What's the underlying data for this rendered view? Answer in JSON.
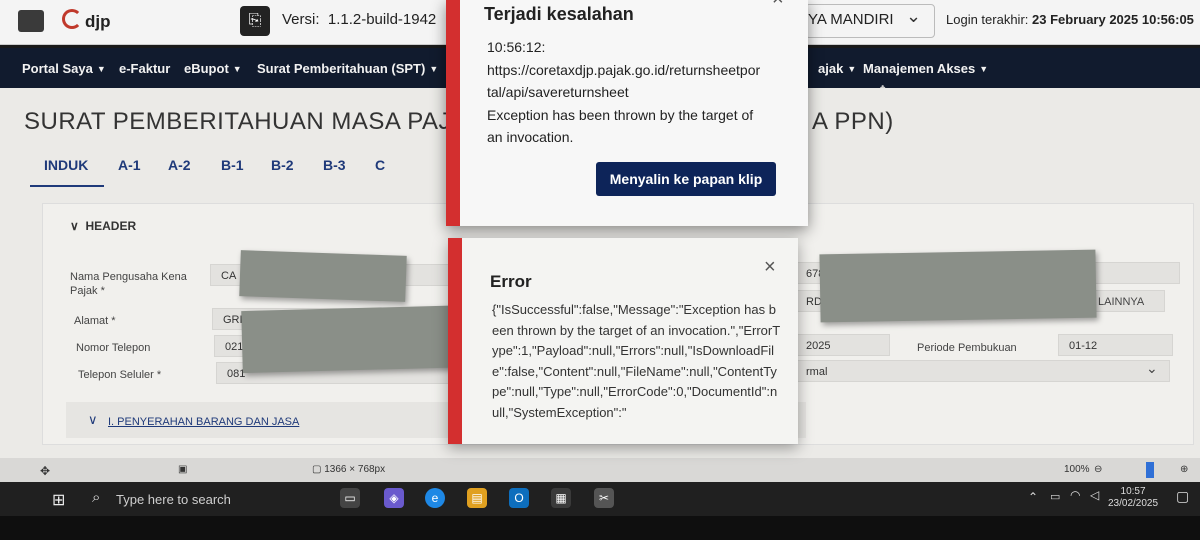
{
  "header": {
    "brand": "djp",
    "version_label": "Versi:",
    "version_value": "1.1.2-build-1942",
    "company_partial": "YA MANDIRI",
    "login_label": "Login terakhir:",
    "login_value": "23 February 2025 10:56:05"
  },
  "nav": {
    "items": [
      "Portal Saya",
      "e-Faktur",
      "eBupot",
      "Surat Pemberitahuan (SPT)",
      "ajak",
      "Manajemen Akses"
    ]
  },
  "page": {
    "title_left": "SURAT PEMBERITAHUAN MASA PAJAK",
    "title_right": "A PPN)",
    "tabs": [
      "INDUK",
      "A-1",
      "A-2",
      "B-1",
      "B-2",
      "B-3",
      "C"
    ],
    "section_header": "HEADER",
    "fields": {
      "nama_label": "Nama Pengusaha Kena Pajak *",
      "nama_value": "CA",
      "alamat_label": "Alamat *",
      "alamat_value": "GRI",
      "telepon_label": "Nomor Telepon",
      "telepon_value": "021",
      "seluler_label": "Telepon Seluler *",
      "seluler_value": "081",
      "right_1": "678.",
      "right_2": "RDA",
      "right_2b": "LAINNYA",
      "right_3": "2025",
      "periode_label": "Periode Pembukuan",
      "periode_value": "01-12",
      "right_4": "rmal"
    },
    "section_link": "I. PENYERAHAN BARANG DAN JASA"
  },
  "statusbar": {
    "resolution": "1366 × 768px",
    "zoom": "100%"
  },
  "taskbar": {
    "search_placeholder": "Type here to search",
    "time": "10:57",
    "date": "23/02/2025"
  },
  "modal_error_main": {
    "title": "Terjadi kesalahan",
    "body": "10:56:12:\nhttps://coretaxdjp.pajak.go.id/returnsheetpor\ntal/api/savereturnsheet\nException has been thrown by the target of\nan invocation.",
    "button": "Menyalin ke papan klip"
  },
  "modal_error_detail": {
    "title": "Error",
    "body": "{\"IsSuccessful\":false,\"Message\":\"Exception has been thrown by the target of an invocation.\",\"ErrorType\":1,\"Payload\":null,\"Errors\":null,\"IsDownloadFile\":false,\"Content\":null,\"FileName\":null,\"ContentType\":null,\"Type\":null,\"ErrorCode\":0,\"DocumentId\":null,\"SystemException\":\""
  },
  "colors": {
    "nav_bg": "#111b2e",
    "accent": "#0d2459",
    "error_stripe": "#d32f2f"
  }
}
